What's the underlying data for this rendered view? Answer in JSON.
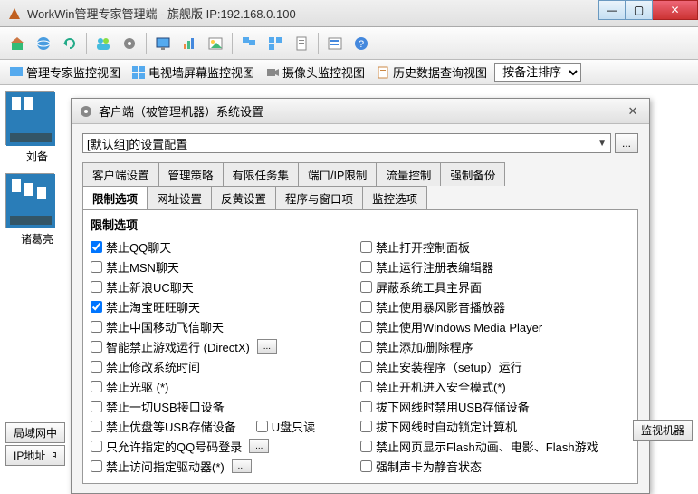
{
  "titlebar": {
    "title": "WorkWin管理专家管理端 - 旗舰版 IP:192.168.0.100"
  },
  "win": {
    "min": "—",
    "max": "▢",
    "close": "✕"
  },
  "viewtabs": {
    "v1": "管理专家监控视图",
    "v2": "电视墙屏幕监控视图",
    "v3": "摄像头监控视图",
    "v4": "历史数据查询视图",
    "sort": "按备注排序"
  },
  "thumbs": {
    "t1": "刘备",
    "t2": "诸葛亮"
  },
  "dialog": {
    "title": "客户端（被管理机器）系统设置",
    "close": "✕",
    "combo": "[默认组]的设置配置",
    "browse": "...",
    "tabs_row1": [
      "客户端设置",
      "管理策略",
      "有限任务集",
      "端口/IP限制",
      "流量控制",
      "强制备份"
    ],
    "tabs_row2": [
      "限制选项",
      "网址设置",
      "反黄设置",
      "程序与窗口项",
      "监控选项"
    ],
    "group_title": "限制选项",
    "left": [
      {
        "label": "禁止QQ聊天",
        "checked": true
      },
      {
        "label": "禁止MSN聊天",
        "checked": false
      },
      {
        "label": "禁止新浪UC聊天",
        "checked": false
      },
      {
        "label": "禁止淘宝旺旺聊天",
        "checked": true
      },
      {
        "label": "禁止中国移动飞信聊天",
        "checked": false
      },
      {
        "label": "智能禁止游戏运行 (DirectX)",
        "checked": false,
        "btn": true
      },
      {
        "label": "禁止修改系统时间",
        "checked": false
      },
      {
        "label": "禁止光驱 (*)",
        "checked": false
      },
      {
        "label": "禁止一切USB接口设备",
        "checked": false
      },
      {
        "label": "禁止优盘等USB存储设备",
        "checked": false,
        "mid": "U盘只读"
      },
      {
        "label": "只允许指定的QQ号码登录",
        "checked": false,
        "btn": true
      },
      {
        "label": "禁止访问指定驱动器(*)",
        "checked": false,
        "btn": true
      }
    ],
    "right": [
      {
        "label": "禁止打开控制面板",
        "checked": false
      },
      {
        "label": "禁止运行注册表编辑器",
        "checked": false
      },
      {
        "label": "屏蔽系统工具主界面",
        "checked": false
      },
      {
        "label": "禁止使用暴风影音播放器",
        "checked": false
      },
      {
        "label": "禁止使用Windows Media Player",
        "checked": false
      },
      {
        "label": "禁止添加/删除程序",
        "checked": false
      },
      {
        "label": "禁止安装程序（setup）运行",
        "checked": false
      },
      {
        "label": "禁止开机进入安全模式(*)",
        "checked": false
      },
      {
        "label": "拔下网线时禁用USB存储设备",
        "checked": false
      },
      {
        "label": "拔下网线时自动锁定计算机",
        "checked": false
      },
      {
        "label": "禁止网页显示Flash动画、电影、Flash游戏",
        "checked": false
      },
      {
        "label": "强制声卡为静音状态",
        "checked": false
      }
    ],
    "extra_btn": "..."
  },
  "bottom": {
    "b1": "局域网中",
    "b2": "IP地址",
    "r1": "监视机器"
  }
}
